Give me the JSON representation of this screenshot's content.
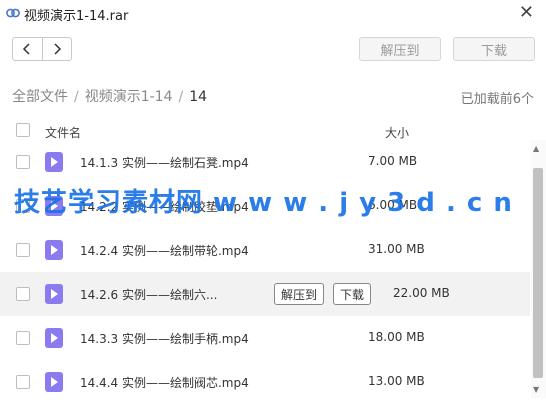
{
  "window": {
    "title": "视频演示1-14.rar",
    "close_label": "✕"
  },
  "nav": {
    "back_label": "<",
    "forward_label": ">"
  },
  "toolbar": {
    "extract_label": "解压到",
    "download_label": "下载"
  },
  "breadcrumb": {
    "root": "全部文件",
    "middle": "视频演示1-14",
    "current": "14",
    "sep": "/"
  },
  "status": {
    "loaded_text": "已加载前6个"
  },
  "columns": {
    "name": "文件名",
    "size": "大小"
  },
  "files": [
    {
      "name": "14.1.3 实例——绘制石凳.mp4",
      "size": "7.00 MB"
    },
    {
      "name": "14.2.2 实例——绘制胶垫.mp4",
      "size": "6.00 MB"
    },
    {
      "name": "14.2.4 实例——绘制带轮.mp4",
      "size": "31.00 MB"
    },
    {
      "name": "14.2.6 实例——绘制六...",
      "size": "22.00 MB",
      "extract_label": "解压到",
      "download_label": "下载"
    },
    {
      "name": "14.3.3 实例——绘制手柄.mp4",
      "size": "18.00 MB"
    },
    {
      "name": "14.4.4 实例——绘制阀芯.mp4",
      "size": "13.00 MB"
    }
  ],
  "watermark": "技艺学习素材网  w w w . j y 3 d . c n",
  "colors": {
    "file_icon": "#8a7cf0",
    "watermark": "#1a73e8"
  }
}
